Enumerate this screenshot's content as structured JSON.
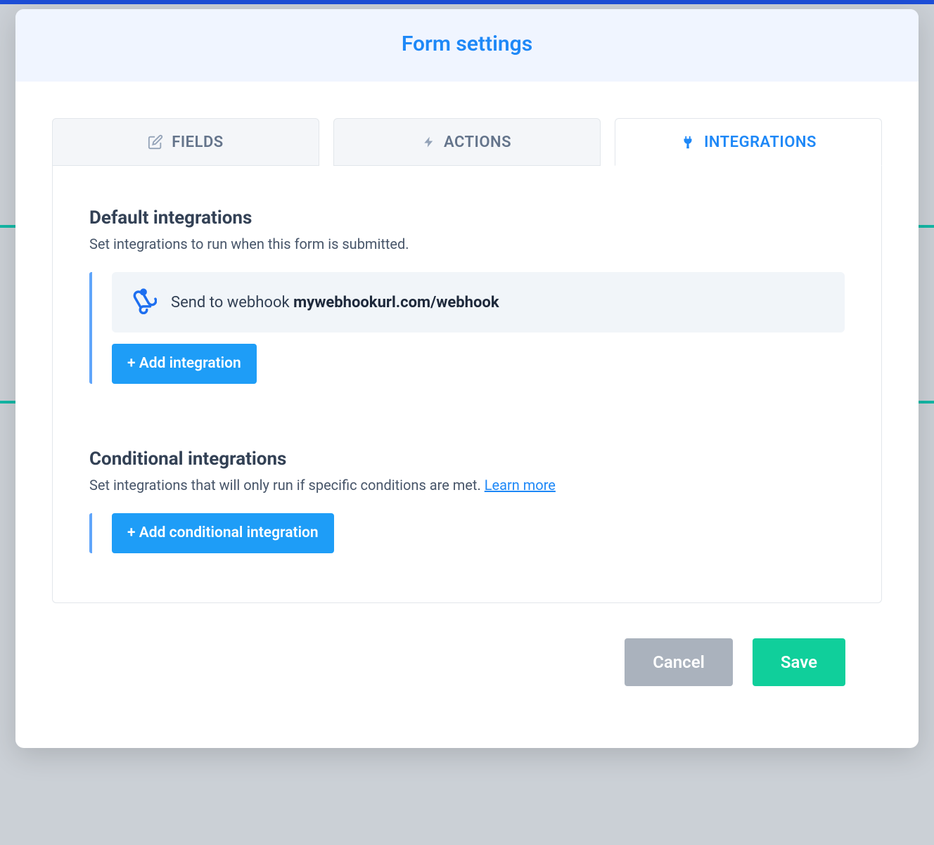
{
  "modal": {
    "title": "Form settings"
  },
  "tabs": {
    "fields": {
      "label": "FIELDS"
    },
    "actions": {
      "label": "ACTIONS"
    },
    "integrations": {
      "label": "INTEGRATIONS"
    }
  },
  "default_section": {
    "title": "Default integrations",
    "description": "Set integrations to run when this form is submitted.",
    "item_prefix": "Send to webhook ",
    "item_target": "mywebhookurl.com/webhook",
    "add_button": "+ Add integration"
  },
  "conditional_section": {
    "title": "Conditional integrations",
    "description_prefix": "Set integrations that will only run if specific conditions are met. ",
    "learn_more": "Learn more",
    "add_button": "+ Add conditional integration"
  },
  "footer": {
    "cancel": "Cancel",
    "save": "Save"
  }
}
